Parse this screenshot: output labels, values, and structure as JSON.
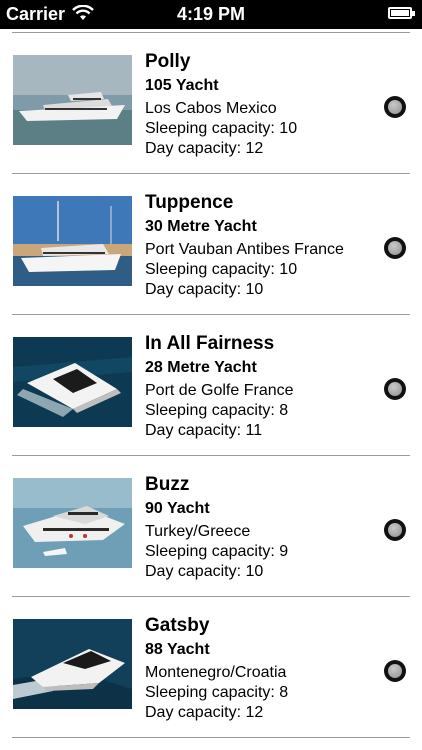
{
  "status_bar": {
    "carrier": "Carrier",
    "time": "4:19 PM",
    "wifi_icon": "wifi-icon",
    "battery_icon": "battery-icon"
  },
  "yachts": [
    {
      "name": "Polly",
      "type": "105 Yacht",
      "location": "Los Cabos Mexico",
      "sleeping": "Sleeping capacity: 10",
      "day": "Day capacity: 12"
    },
    {
      "name": "Tuppence",
      "type": "30 Metre Yacht",
      "location": "Port Vauban Antibes France",
      "sleeping": "Sleeping capacity: 10",
      "day": "Day capacity: 10"
    },
    {
      "name": "In All Fairness",
      "type": "28 Metre Yacht",
      "location": "Port de Golfe France",
      "sleeping": "Sleeping capacity: 8",
      "day": "Day capacity: 11"
    },
    {
      "name": "Buzz",
      "type": "90 Yacht",
      "location": "Turkey/Greece",
      "sleeping": "Sleeping capacity: 9",
      "day": "Day capacity: 10"
    },
    {
      "name": "Gatsby",
      "type": "88 Yacht",
      "location": "Montenegro/Croatia",
      "sleeping": "Sleeping capacity: 8",
      "day": "Day capacity: 12"
    }
  ],
  "colors": {
    "status_bar": "#000000",
    "divider": "#9a9a9a",
    "text": "#000000"
  }
}
